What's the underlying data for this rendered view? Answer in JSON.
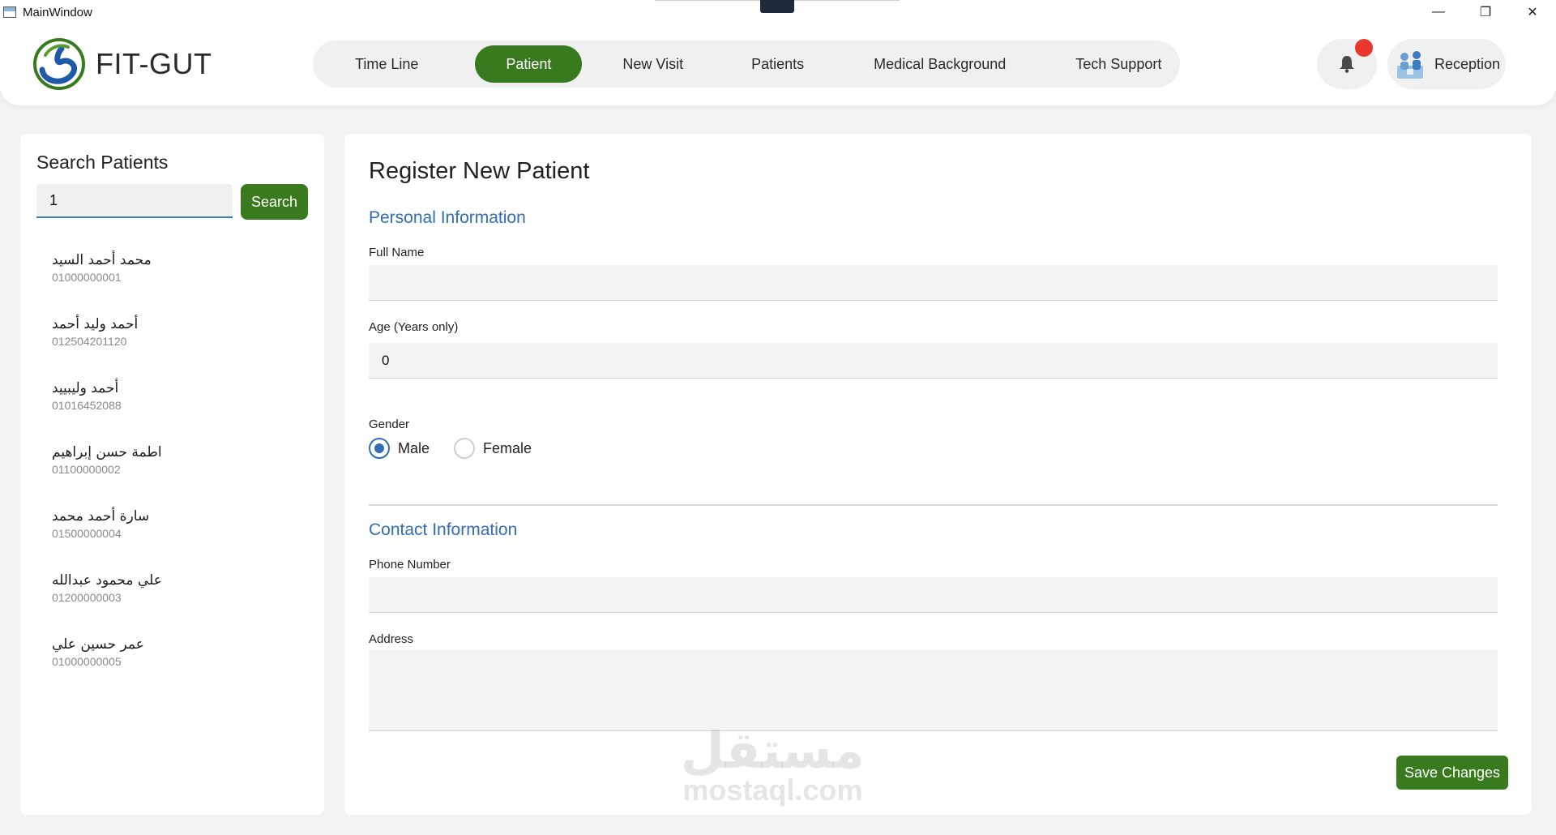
{
  "window": {
    "title": "MainWindow",
    "minimize_glyph": "—",
    "maximize_glyph": "❐",
    "close_glyph": "✕"
  },
  "header": {
    "brand": "FIT-GUT",
    "nav": [
      {
        "label": "Time Line",
        "active": false
      },
      {
        "label": "Patient",
        "active": true
      },
      {
        "label": "New Visit",
        "active": false
      },
      {
        "label": "Patients",
        "active": false
      },
      {
        "label": "Medical Background",
        "active": false
      },
      {
        "label": "Tech Support",
        "active": false
      }
    ],
    "user_role": "Reception",
    "notification_icon": "bell-icon"
  },
  "search": {
    "title": "Search Patients",
    "query": "1",
    "button_label": "Search"
  },
  "patients": [
    {
      "name": "محمد أحمد السيد",
      "phone": "01000000001"
    },
    {
      "name": "أحمد وليد أحمد",
      "phone": "012504201120"
    },
    {
      "name": "أحمد وليبييد",
      "phone": "01016452088"
    },
    {
      "name": "اطمة حسن إبراهيم",
      "phone": "01100000002"
    },
    {
      "name": "سارة أحمد محمد",
      "phone": "01500000004"
    },
    {
      "name": "علي محمود عبدالله",
      "phone": "01200000003"
    },
    {
      "name": "عمر حسين علي",
      "phone": "01000000005"
    }
  ],
  "form": {
    "title": "Register New Patient",
    "personal_section": "Personal Information",
    "full_name_label": "Full Name",
    "full_name_value": "",
    "age_label": "Age (Years only)",
    "age_value": "0",
    "gender_label": "Gender",
    "gender_options": [
      "Male",
      "Female"
    ],
    "gender_selected": "Male",
    "contact_section": "Contact Information",
    "phone_label": "Phone Number",
    "phone_value": "",
    "address_label": "Address",
    "address_value": "",
    "save_label": "Save Changes"
  },
  "watermark": {
    "arabic": "مستقل",
    "latin": "mostaql.com"
  },
  "colors": {
    "accent_green": "#3a7a1f",
    "accent_blue": "#2f6db5",
    "notification_red": "#e8372c"
  }
}
